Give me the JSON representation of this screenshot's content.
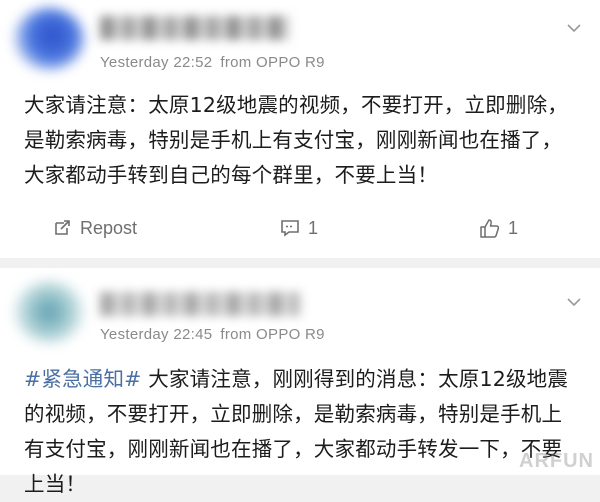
{
  "posts": [
    {
      "time": "Yesterday 22:52",
      "source": "from OPPO R9",
      "text": "大家请注意：太原12级地震的视频，不要打开，立即删除，是勒索病毒，特别是手机上有支付宝，刚刚新闻也在播了，大家都动手转到自己的每个群里，不要上当！",
      "actions": {
        "repost_label": "Repost",
        "comment_count": "1",
        "like_count": "1"
      }
    },
    {
      "time": "Yesterday 22:45",
      "source": "from OPPO R9",
      "hashtag": "#紧急通知#",
      "text": " 大家请注意，刚刚得到的消息：太原12级地震的视频，不要打开，立即删除，是勒索病毒，特别是手机上有支付宝，刚刚新闻也在播了，大家都动手转发一下，不要上当！"
    }
  ],
  "watermark": "ARFUN"
}
